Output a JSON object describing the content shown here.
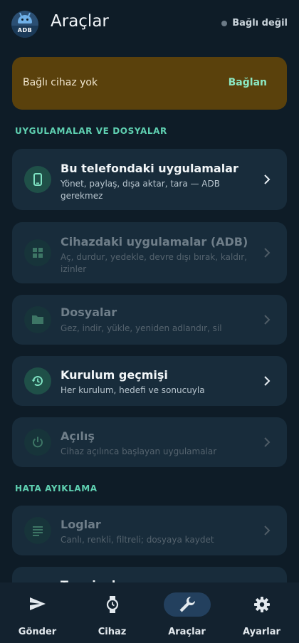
{
  "header": {
    "title": "Araçlar",
    "status": "Bağlı değil",
    "logo_text": "ADB"
  },
  "banner": {
    "text": "Bağlı cihaz yok",
    "action": "Bağlan"
  },
  "sections": {
    "apps_files": "UYGULAMALAR VE DOSYALAR",
    "debug": "HATA AYIKLAMA"
  },
  "cards": [
    {
      "title": "Bu telefondaki uygulamalar",
      "subtitle": "Yönet, paylaş, dışa aktar, tara — ADB gerekmez",
      "icon": "phone-icon",
      "enabled": true
    },
    {
      "title": "Cihazdaki uygulamalar (ADB)",
      "subtitle": "Aç, durdur, yedekle, devre dışı bırak, kaldır, izinler",
      "icon": "apps-grid-icon",
      "enabled": false
    },
    {
      "title": "Dosyalar",
      "subtitle": "Gez, indir, yükle, yeniden adlandır, sil",
      "icon": "folder-icon",
      "enabled": false
    },
    {
      "title": "Kurulum geçmişi",
      "subtitle": "Her kurulum, hedefi ve sonucuyla",
      "icon": "history-icon",
      "enabled": true
    },
    {
      "title": "Açılış",
      "subtitle": "Cihaz açılınca başlayan uygulamalar",
      "icon": "power-icon",
      "enabled": false
    },
    {
      "title": "Loglar",
      "subtitle": "Canlı, renkli, filtreli; dosyaya kaydet",
      "icon": "logs-icon",
      "enabled": false
    }
  ],
  "partial_card_title": "Terminal",
  "bottom_nav": [
    {
      "label": "Gönder",
      "icon": "send-icon",
      "active": false
    },
    {
      "label": "Cihaz",
      "icon": "watch-icon",
      "active": false
    },
    {
      "label": "Araçlar",
      "icon": "wrench-icon",
      "active": true
    },
    {
      "label": "Ayarlar",
      "icon": "gear-icon",
      "active": false
    }
  ],
  "colors": {
    "background": "#0e1c27",
    "card": "#182c3b",
    "accent": "#5fd0b1",
    "banner": "#5a410c"
  }
}
